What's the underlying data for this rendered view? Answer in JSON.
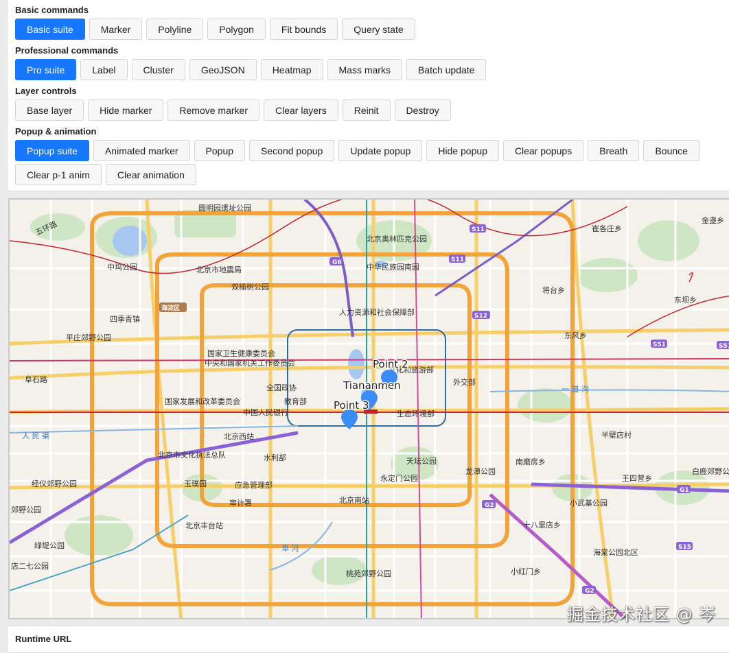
{
  "groups": {
    "basic": {
      "title": "Basic commands",
      "buttons": [
        "Basic suite",
        "Marker",
        "Polyline",
        "Polygon",
        "Fit bounds",
        "Query state"
      ]
    },
    "pro": {
      "title": "Professional commands",
      "buttons": [
        "Pro suite",
        "Label",
        "Cluster",
        "GeoJSON",
        "Heatmap",
        "Mass marks",
        "Batch update"
      ]
    },
    "layer": {
      "title": "Layer controls",
      "buttons": [
        "Base layer",
        "Hide marker",
        "Remove marker",
        "Clear layers",
        "Reinit",
        "Destroy"
      ]
    },
    "popup": {
      "title": "Popup & animation",
      "buttons": [
        "Popup suite",
        "Animated marker",
        "Popup",
        "Second popup",
        "Update popup",
        "Hide popup",
        "Clear popups",
        "Breath",
        "Bounce",
        "Clear p-1 anim",
        "Clear animation"
      ]
    }
  },
  "map": {
    "markers": [
      "Point 2",
      "Tiananmen",
      "Point 3"
    ],
    "place_labels": [
      "圆明园遗址公园",
      "北京奥林匹克公园",
      "五环路",
      "中坞公园",
      "北京市地震局",
      "中华民族园南园",
      "双榆树公园",
      "海淀区",
      "四季青镇",
      "人力资源和社会保障部",
      "平庄郊野公园",
      "国家卫生健康委员会",
      "中央和国家机关工作委员会",
      "文化和旅游部",
      "阜石路",
      "全国政协",
      "外交部",
      "国家发展和改革委员会",
      "教育部",
      "中国人民银行",
      "生态环境部",
      "北京西站",
      "北京市文化执法总队",
      "水利部",
      "天坛公园",
      "永定门公园",
      "龙潭公园",
      "玉璞园",
      "应急管理部",
      "审计署",
      "北京南站",
      "经仪郊野公园",
      "北京丰台站",
      "绿堤公园",
      "桃苑郊野公园",
      "小红门乡",
      "海棠公园北区",
      "十八里店乡",
      "小武基公园",
      "王四营乡",
      "南磨房乡",
      "半壁店村",
      "东风乡",
      "将台乡",
      "东坝乡",
      "崔各庄乡",
      "金盏乡",
      "白鹿郊野公园",
      "店二七公园",
      "郊野公园",
      "人 民 渠",
      "一 道 沟",
      "阜 河"
    ],
    "road_shields": [
      "S11",
      "G6",
      "S12",
      "S51",
      "G2",
      "G1",
      "S15",
      "五环路"
    ],
    "watermark": "掘金技术社区 @ 岑"
  },
  "bottom": {
    "title": "Runtime URL"
  },
  "colors": {
    "primary": "#1677ff",
    "marker": "#3b8cf6"
  }
}
